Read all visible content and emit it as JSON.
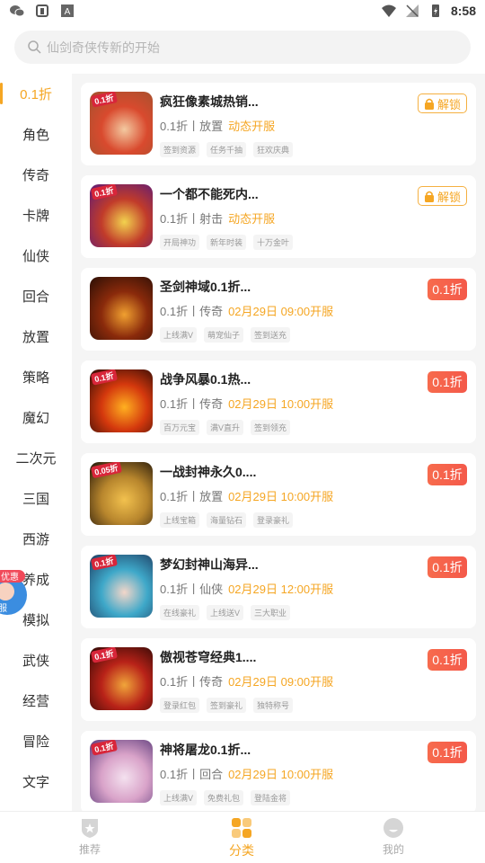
{
  "status_bar": {
    "time": "8:58"
  },
  "search": {
    "placeholder": "仙剑奇侠传新的开始"
  },
  "sidebar": {
    "items": [
      {
        "label": "0.1折",
        "active": true
      },
      {
        "label": "角色"
      },
      {
        "label": "传奇"
      },
      {
        "label": "卡牌"
      },
      {
        "label": "仙侠"
      },
      {
        "label": "回合"
      },
      {
        "label": "放置"
      },
      {
        "label": "策略"
      },
      {
        "label": "魔幻"
      },
      {
        "label": "二次元"
      },
      {
        "label": "三国"
      },
      {
        "label": "西游"
      },
      {
        "label": "养成"
      },
      {
        "label": "模拟"
      },
      {
        "label": "武侠"
      },
      {
        "label": "经营"
      },
      {
        "label": "冒险"
      },
      {
        "label": "文字"
      }
    ],
    "float_badge": {
      "label": "优惠",
      "sub": "服"
    }
  },
  "games": [
    {
      "title": "疯狂像素城热销...",
      "genre": "0.1折丨放置",
      "status": "动态开服",
      "tags": [
        "签到资源",
        "任务千抽",
        "狂欢庆典"
      ],
      "action": "解锁",
      "action_type": "unlock",
      "thumb_tag": "0.1折"
    },
    {
      "title": "一个都不能死内...",
      "genre": "0.1折丨射击",
      "status": "动态开服",
      "tags": [
        "开局神功",
        "新年时装",
        "十万金叶"
      ],
      "action": "解锁",
      "action_type": "unlock",
      "thumb_tag": "0.1折"
    },
    {
      "title": "圣剑神域0.1折...",
      "genre": "0.1折丨传奇",
      "status": "02月29日 09:00开服",
      "tags": [
        "上线满V",
        "萌宠仙子",
        "签到送充"
      ],
      "action": "0.1折",
      "action_type": "discount",
      "thumb_tag": ""
    },
    {
      "title": "战争风暴0.1热...",
      "genre": "0.1折丨传奇",
      "status": "02月29日 10:00开服",
      "tags": [
        "百万元宝",
        "满V直升",
        "签到领充"
      ],
      "action": "0.1折",
      "action_type": "discount",
      "thumb_tag": "0.1折"
    },
    {
      "title": "一战封神永久0....",
      "genre": "0.1折丨放置",
      "status": "02月29日 10:00开服",
      "tags": [
        "上线宝箱",
        "海量钻石",
        "登录豪礼"
      ],
      "action": "0.1折",
      "action_type": "discount",
      "thumb_tag": "0.05折"
    },
    {
      "title": "梦幻封神山海异...",
      "genre": "0.1折丨仙侠",
      "status": "02月29日 12:00开服",
      "tags": [
        "在线豪礼",
        "上线送V",
        "三大职业"
      ],
      "action": "0.1折",
      "action_type": "discount",
      "thumb_tag": "0.1折"
    },
    {
      "title": "傲视苍穹经典1....",
      "genre": "0.1折丨传奇",
      "status": "02月29日 09:00开服",
      "tags": [
        "登录红包",
        "签到豪礼",
        "独特称号"
      ],
      "action": "0.1折",
      "action_type": "discount",
      "thumb_tag": "0.1折"
    },
    {
      "title": "神将屠龙0.1折...",
      "genre": "0.1折丨回合",
      "status": "02月29日 10:00开服",
      "tags": [
        "上线满V",
        "免费礼包",
        "登陆金将"
      ],
      "action": "0.1折",
      "action_type": "discount",
      "thumb_tag": "0.1折"
    }
  ],
  "bottom_nav": [
    {
      "label": "推荐",
      "icon": "shield-star-icon"
    },
    {
      "label": "分类",
      "icon": "grid-icon",
      "active": true
    },
    {
      "label": "我的",
      "icon": "face-icon"
    }
  ],
  "colors": {
    "accent": "#f5a623",
    "discount": "#f4594a"
  }
}
